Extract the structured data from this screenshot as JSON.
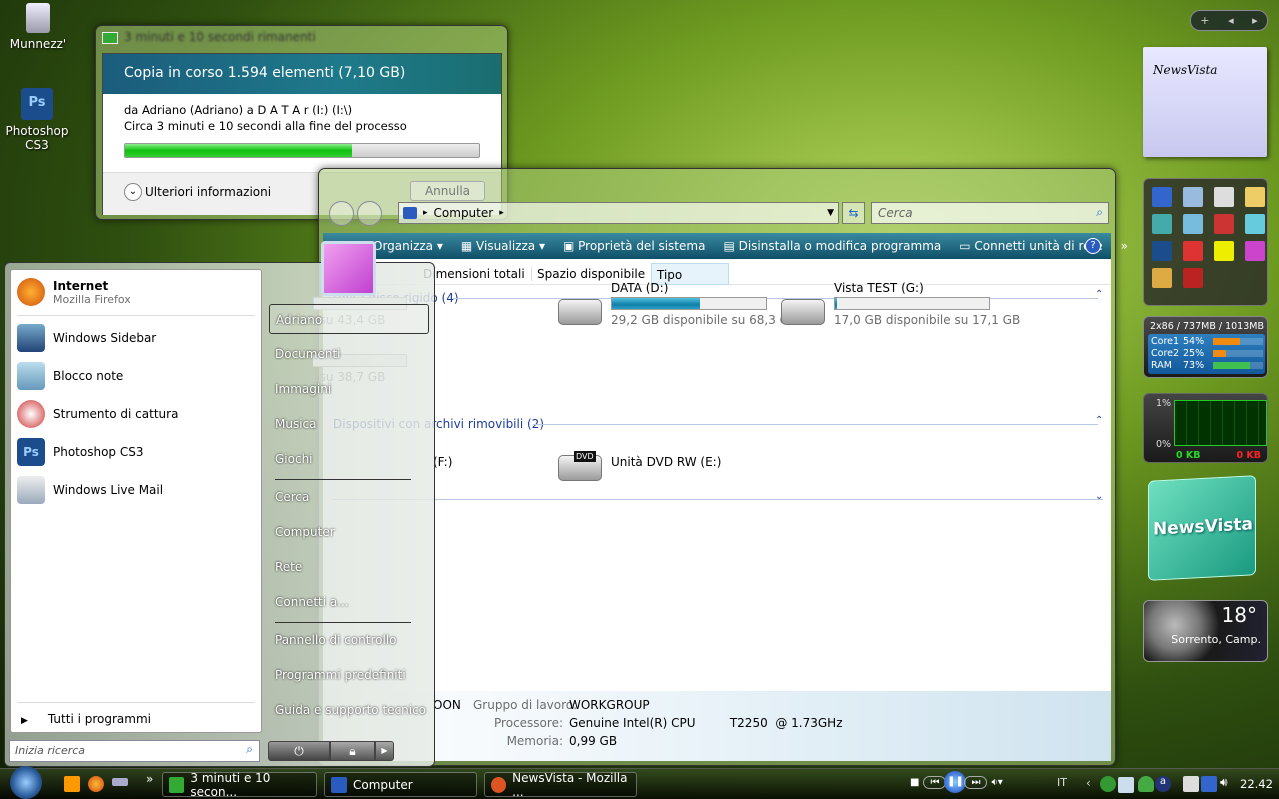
{
  "desktop": {
    "icons": [
      {
        "label": "Munnezz'",
        "icon": "recycle-bin-icon"
      },
      {
        "label": "Photoshop CS3",
        "icon": "photoshop-icon"
      }
    ]
  },
  "copy_dialog": {
    "title": "3 minuti e 10 secondi rimanenti",
    "heading": "Copia in corso 1.594 elementi (7,10 GB)",
    "from_to": "da Adriano (Adriano) a D A T A r (I:) (I:\\)",
    "eta": "Circa 3 minuti e 10 secondi alla fine del processo",
    "progress_percent": 64,
    "more_info": "Ulteriori informazioni",
    "cancel": "Annulla"
  },
  "explorer": {
    "address": "Computer",
    "search_placeholder": "Cerca",
    "toolbar": [
      "Organizza",
      "Visualizza",
      "Proprietà del sistema",
      "Disinstalla o modifica programma",
      "Connetti unità di rete"
    ],
    "overflow": "»",
    "columns": [
      "Dimensioni totali",
      "Spazio disponibile",
      "Tipo"
    ],
    "groups": [
      {
        "label": "Unità disco rigido (4)"
      },
      {
        "label": "Dispositivi con archivi rimovibili (2)"
      }
    ],
    "drives": [
      {
        "name": "",
        "free": "disponibile su 43,4 GB",
        "fill": 0.4
      },
      {
        "name": "DATA (D:)",
        "free": "29,2 GB disponibile su 68,3 GB",
        "fill": 0.57
      },
      {
        "name": "Vista TEST (G:)",
        "free": "17,0 GB disponibile su 17,1 GB",
        "fill": 0.01
      },
      {
        "name": "(I:)",
        "free": "disponibile su 38,7 GB",
        "fill": 0.02
      }
    ],
    "removable": [
      {
        "name": "(F:)"
      },
      {
        "name": "Unità DVD RW (E:)",
        "badge": "DVD"
      }
    ],
    "details": {
      "computer_fragment": "OON",
      "workgroup_label": "Gruppo di lavoro:",
      "workgroup": "WORKGROUP",
      "cpu_label": "Processore:",
      "cpu": "Genuine Intel(R) CPU         T2250  @ 1.73GHz",
      "mem_label": "Memoria:",
      "mem": "0,99 GB"
    }
  },
  "start_menu": {
    "pinned": [
      {
        "title": "Internet",
        "subtitle": "Mozilla Firefox"
      }
    ],
    "recent": [
      "Windows Sidebar",
      "Blocco note",
      "Strumento di cattura",
      "Photoshop CS3",
      "Windows Live Mail"
    ],
    "all_programs": "Tutti i programmi",
    "search_placeholder": "Inizia ricerca",
    "right": [
      "Adriano",
      "Documenti",
      "Immagini",
      "Musica",
      "Giochi",
      "Cerca",
      "Computer",
      "Rete",
      "Connetti a...",
      "Pannello di controllo",
      "Programmi predefiniti",
      "Guida e supporto tecnico"
    ]
  },
  "sidebar": {
    "notes": "NewsVista",
    "cpu": {
      "header": "2x86 / 737MB / 1013MB",
      "rows": [
        {
          "label": "Core1",
          "value": "54%",
          "pct": 54
        },
        {
          "label": "Core2",
          "value": "25%",
          "pct": 25
        },
        {
          "label": "RAM",
          "value": "73%",
          "pct": 73
        }
      ]
    },
    "network": {
      "top": "1%",
      "bottom": "0%",
      "in": "0 KB",
      "out": "0 KB"
    },
    "logo": "NewsVista",
    "weather": {
      "temp": "18°",
      "city": "Sorrento, Camp."
    }
  },
  "taskbar": {
    "tasks": [
      "3 minuti e 10 secon...",
      "Computer",
      "NewsVista - Mozilla ..."
    ],
    "quicklaunch_more": "»",
    "lang": "IT",
    "clock": "22.42"
  },
  "colors": {
    "accent": "#1e6f86",
    "progress": "#1dc41d",
    "cpu_bar": "#f08a10",
    "ram_bar": "#40c050"
  }
}
